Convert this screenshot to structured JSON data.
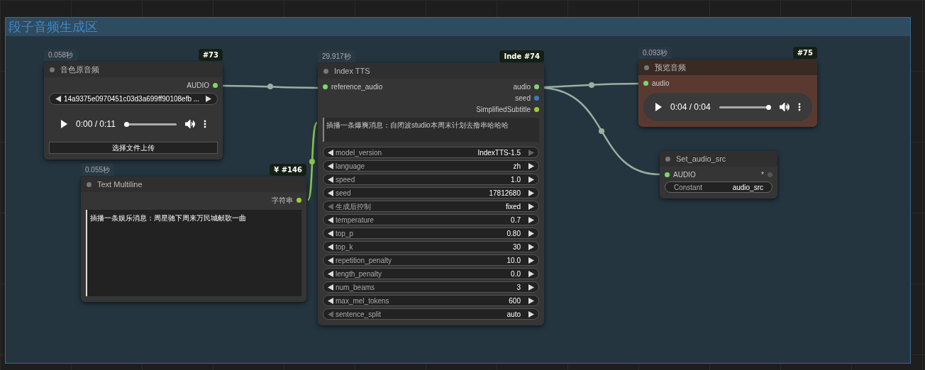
{
  "group": {
    "title": "段子音频生成区"
  },
  "nodes": [
    {
      "kind": "load_audio",
      "time": "0.058秒",
      "badge": "#73",
      "title": "音色原音频",
      "outputs": [
        {
          "label": "AUDIO",
          "color": "#7bd86b"
        }
      ],
      "file": "14a9375e0970451c03d3a699ff90108efb ...",
      "player": {
        "time": "0:00 / 0:11",
        "level": 0
      },
      "upload": "选择文件上传"
    },
    {
      "kind": "text_multiline",
      "time": "0.055秒",
      "badge_prefix": "¥",
      "badge": "#146",
      "title": "Text Multiline",
      "outputs": [
        {
          "label": "字符串",
          "color": "#9acd32"
        }
      ],
      "text": "插播一条娱乐消息：周星驰下周来万民城献歌一曲"
    },
    {
      "kind": "index_tts",
      "time": "29.917秒",
      "badge_prefix": "Inde",
      "badge": "#74",
      "title": "Index TTS",
      "inputs": [
        {
          "label": "reference_audio",
          "color": "#7bd86b"
        }
      ],
      "outputs": [
        {
          "label": "audio",
          "color": "#7bd86b"
        },
        {
          "label": "seed",
          "color": "#3b7bbf"
        },
        {
          "label": "SimplifiedSubtitle",
          "color": "#9acd32"
        }
      ],
      "text": "插播一条爆爽消息：自闭波studio本周末计划去撸串哈哈哈",
      "widgets": [
        {
          "label": "model_version",
          "value": "IndexTTS-1.5",
          "prev_disabled": false,
          "next_disabled": true
        },
        {
          "label": "language",
          "value": "zh",
          "prev_disabled": false,
          "next_disabled": false
        },
        {
          "label": "speed",
          "value": "1.0",
          "prev_disabled": false,
          "next_disabled": false
        },
        {
          "label": "seed",
          "value": "17812680",
          "prev_disabled": false,
          "next_disabled": false
        },
        {
          "label": "生成后控制",
          "value": "fixed",
          "prev_disabled": true,
          "next_disabled": false
        },
        {
          "label": "temperature",
          "value": "0.7",
          "prev_disabled": false,
          "next_disabled": false
        },
        {
          "label": "top_p",
          "value": "0.80",
          "prev_disabled": false,
          "next_disabled": false
        },
        {
          "label": "top_k",
          "value": "30",
          "prev_disabled": false,
          "next_disabled": false
        },
        {
          "label": "repetition_penalty",
          "value": "10.0",
          "prev_disabled": false,
          "next_disabled": false
        },
        {
          "label": "length_penalty",
          "value": "0.0",
          "prev_disabled": false,
          "next_disabled": false
        },
        {
          "label": "num_beams",
          "value": "3",
          "prev_disabled": false,
          "next_disabled": false
        },
        {
          "label": "max_mel_tokens",
          "value": "600",
          "prev_disabled": false,
          "next_disabled": false
        },
        {
          "label": "sentence_split",
          "value": "auto",
          "prev_disabled": true,
          "next_disabled": false
        }
      ]
    },
    {
      "kind": "preview_audio",
      "time": "0.093秒",
      "badge": "#75",
      "title": "预览音频",
      "inputs": [
        {
          "label": "audio",
          "color": "#7bd86b"
        }
      ],
      "player": {
        "time": "0:04 / 0:04",
        "level": 1
      }
    },
    {
      "kind": "set_node",
      "title": "Set_audio_src",
      "inputs": [
        {
          "label": "AUDIO",
          "color": "#7bd86b"
        }
      ],
      "outputs": [
        {
          "label": "*",
          "color": "#555555"
        }
      ],
      "constant": {
        "label": "Constant",
        "value": "audio_src"
      }
    }
  ]
}
